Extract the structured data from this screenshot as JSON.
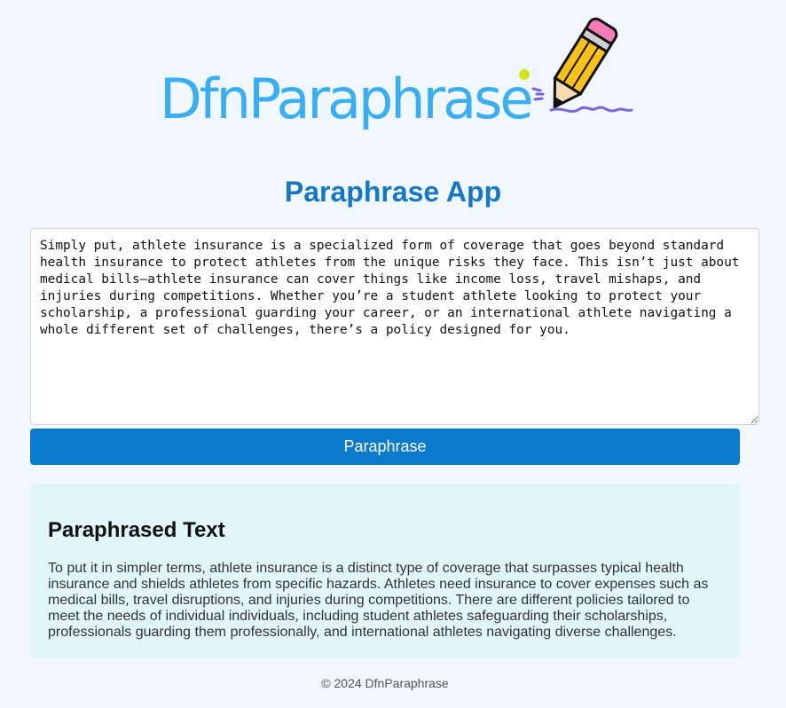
{
  "header": {
    "logo_text": "DfnParaphrase",
    "logo_icon": "pencil-icon"
  },
  "main": {
    "title": "Paraphrase App",
    "input_value": "Simply put, athlete insurance is a specialized form of coverage that goes beyond standard health insurance to protect athletes from the unique risks they face. This isn’t just about medical bills—athlete insurance can cover things like income loss, travel mishaps, and injuries during competitions. Whether you’re a student athlete looking to protect your scholarship, a professional guarding your career, or an international athlete navigating a whole different set of challenges, there’s a policy designed for you.",
    "button_label": "Paraphrase"
  },
  "output": {
    "heading": "Paraphrased Text",
    "text": "To put it in simpler terms, athlete insurance is a distinct type of coverage that surpasses typical health insurance and shields athletes from specific hazards. Athletes need insurance to cover expenses such as medical bills, travel disruptions, and injuries during competitions. There are different policies tailored to meet the needs of individual individuals, including student athletes safeguarding their scholarships, professionals guarding them professionally, and international athletes navigating diverse challenges."
  },
  "footer": {
    "copyright": "© 2024 DfnParaphrase"
  },
  "colors": {
    "background": "#f0f7fe",
    "logo_blue": "#3aaef2",
    "title_blue": "#1677c7",
    "button_blue": "#0a7acd",
    "output_background": "#e0f6f9"
  }
}
